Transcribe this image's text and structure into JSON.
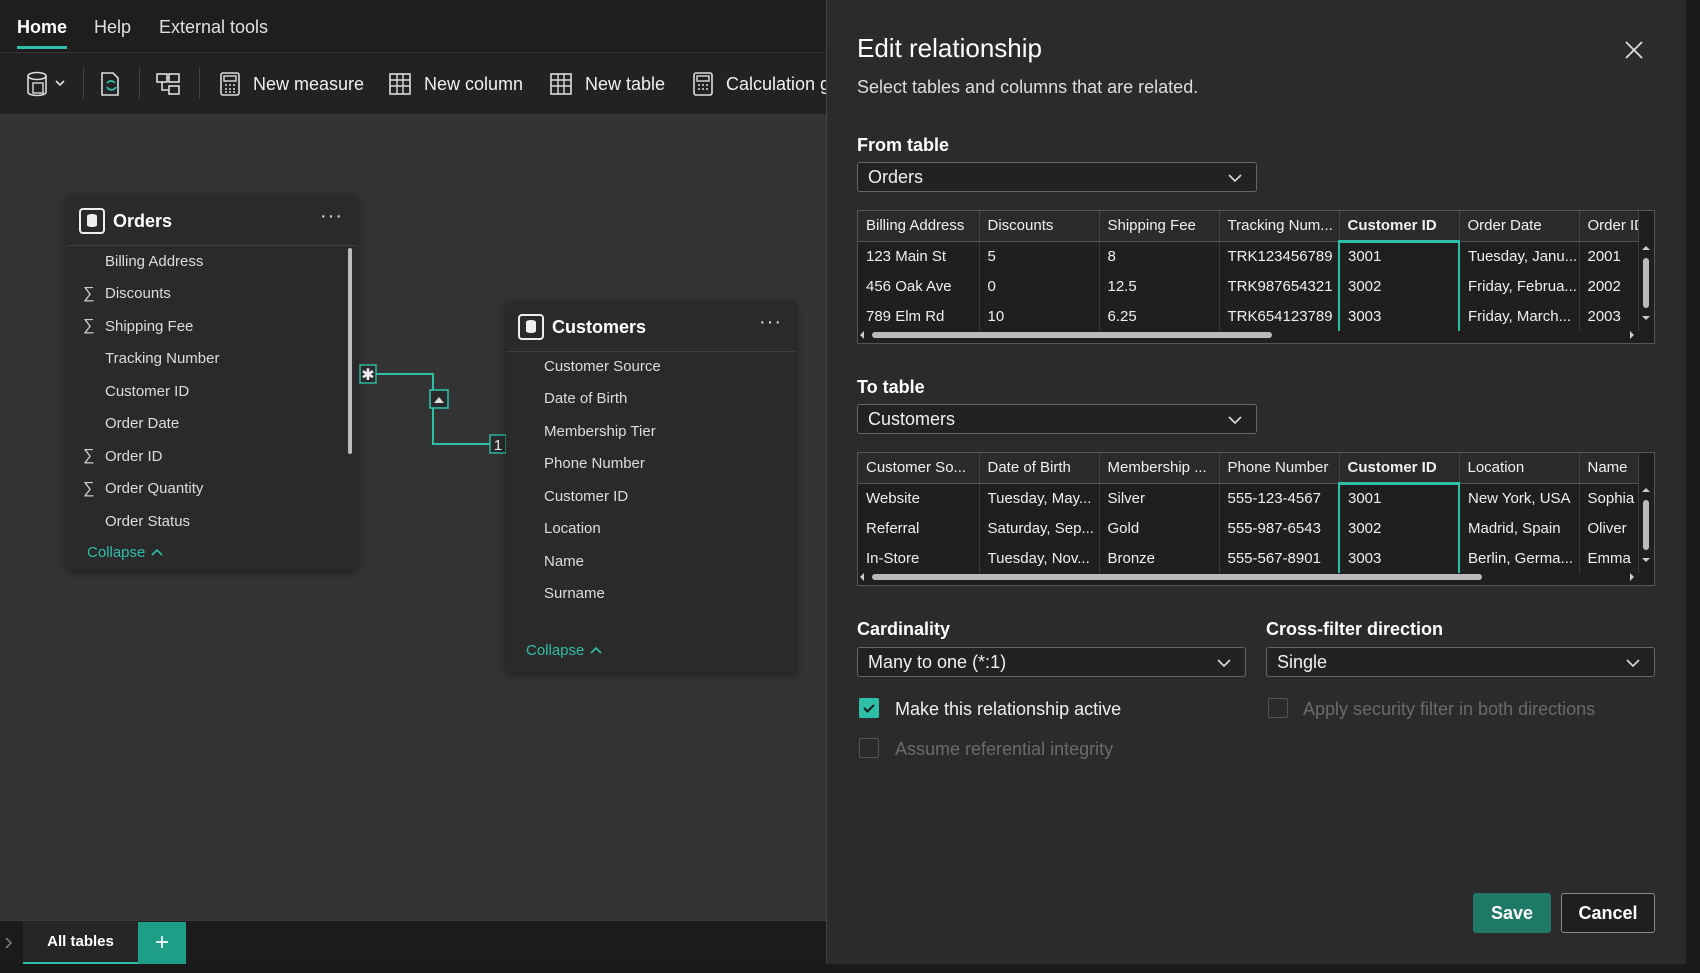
{
  "menu": {
    "tabs": [
      {
        "label": "Home"
      },
      {
        "label": "Help"
      },
      {
        "label": "External tools"
      }
    ]
  },
  "toolbar": {
    "new_measure": "New measure",
    "new_column": "New column",
    "new_table": "New table",
    "calculation": "Calculation g"
  },
  "orders_card": {
    "title": "Orders",
    "fields": [
      {
        "label": "Billing Address"
      },
      {
        "label": "Discounts",
        "icon": "sigma"
      },
      {
        "label": "Shipping Fee",
        "icon": "sigma"
      },
      {
        "label": "Tracking Number"
      },
      {
        "label": "Customer ID"
      },
      {
        "label": "Order Date"
      },
      {
        "label": "Order ID",
        "icon": "sigma"
      },
      {
        "label": "Order Quantity",
        "icon": "sigma"
      },
      {
        "label": "Order Status"
      }
    ],
    "collapse": "Collapse"
  },
  "customers_card": {
    "title": "Customers",
    "fields": [
      {
        "label": "Customer Source"
      },
      {
        "label": "Date of Birth"
      },
      {
        "label": "Membership Tier"
      },
      {
        "label": "Phone Number"
      },
      {
        "label": "Customer ID"
      },
      {
        "label": "Location"
      },
      {
        "label": "Name"
      },
      {
        "label": "Surname"
      }
    ],
    "collapse": "Collapse"
  },
  "relationship_line": {
    "many": "✱",
    "one": "1"
  },
  "tabs": {
    "all_tables": "All tables",
    "add": "+"
  },
  "dialog": {
    "title": "Edit relationship",
    "subtitle": "Select tables and columns that are related.",
    "from_label": "From table",
    "from_value": "Orders",
    "from_grid": {
      "columns": [
        "Billing Address",
        "Discounts",
        "Shipping Fee",
        "Tracking Num...",
        "Customer ID",
        "Order Date",
        "Order ID"
      ],
      "rows": [
        [
          "123 Main St",
          "5",
          "8",
          "TRK123456789",
          "3001",
          "Tuesday, Janu...",
          "2001"
        ],
        [
          "456 Oak Ave",
          "0",
          "12.5",
          "TRK987654321",
          "3002",
          "Friday, Februa...",
          "2002"
        ],
        [
          "789 Elm Rd",
          "10",
          "6.25",
          "TRK654123789",
          "3003",
          "Friday, March...",
          "2003"
        ]
      ]
    },
    "to_label": "To table",
    "to_value": "Customers",
    "to_grid": {
      "columns": [
        "Customer So...",
        "Date of Birth",
        "Membership ...",
        "Phone Number",
        "Customer ID",
        "Location",
        "Name"
      ],
      "rows": [
        [
          "Website",
          "Tuesday, May...",
          "Silver",
          "555-123-4567",
          "3001",
          "New York, USA",
          "Sophia"
        ],
        [
          "Referral",
          "Saturday, Sep...",
          "Gold",
          "555-987-6543",
          "3002",
          "Madrid, Spain",
          "Oliver"
        ],
        [
          "In-Store",
          "Tuesday, Nov...",
          "Bronze",
          "555-567-8901",
          "3003",
          "Berlin, Germa...",
          "Emma"
        ]
      ]
    },
    "cardinality_label": "Cardinality",
    "cardinality_value": "Many to one (*:1)",
    "crossfilter_label": "Cross-filter direction",
    "crossfilter_value": "Single",
    "make_active": "Make this relationship active",
    "apply_security": "Apply security filter in both directions",
    "assume_integrity": "Assume referential integrity",
    "save": "Save",
    "cancel": "Cancel"
  },
  "colors": {
    "accent": "#2dbfa8",
    "save_bg": "#1e7a67"
  }
}
